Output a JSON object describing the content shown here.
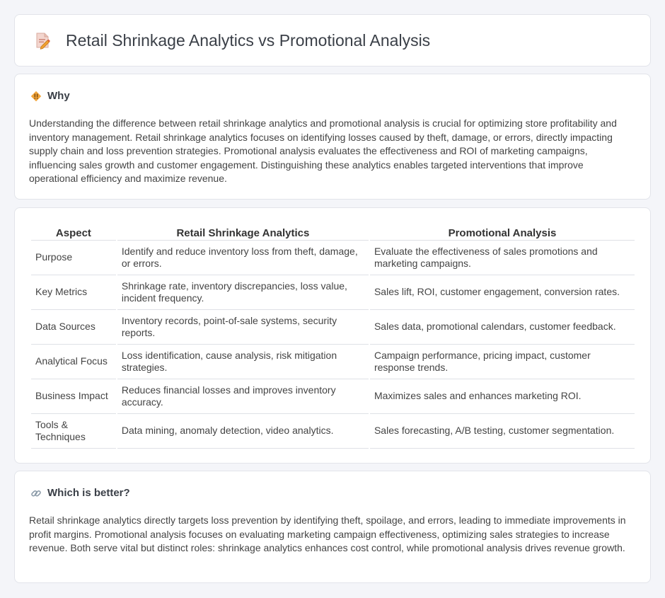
{
  "header": {
    "title": "Retail Shrinkage Analytics vs Promotional Analysis",
    "icon": "document-pencil-icon"
  },
  "why": {
    "title": "Why",
    "icon": "diamond-alert-icon",
    "text": "Understanding the difference between retail shrinkage analytics and promotional analysis is crucial for optimizing store profitability and inventory management. Retail shrinkage analytics focuses on identifying losses caused by theft, damage, or errors, directly impacting supply chain and loss prevention strategies. Promotional analysis evaluates the effectiveness and ROI of marketing campaigns, influencing sales growth and customer engagement. Distinguishing these analytics enables targeted interventions that improve operational efficiency and maximize revenue."
  },
  "table": {
    "headers": [
      "Aspect",
      "Retail Shrinkage Analytics",
      "Promotional Analysis"
    ],
    "rows": [
      [
        "Purpose",
        "Identify and reduce inventory loss from theft, damage, or errors.",
        "Evaluate the effectiveness of sales promotions and marketing campaigns."
      ],
      [
        "Key Metrics",
        "Shrinkage rate, inventory discrepancies, loss value, incident frequency.",
        "Sales lift, ROI, customer engagement, conversion rates."
      ],
      [
        "Data Sources",
        "Inventory records, point-of-sale systems, security reports.",
        "Sales data, promotional calendars, customer feedback."
      ],
      [
        "Analytical Focus",
        "Loss identification, cause analysis, risk mitigation strategies.",
        "Campaign performance, pricing impact, customer response trends."
      ],
      [
        "Business Impact",
        "Reduces financial losses and improves inventory accuracy.",
        "Maximizes sales and enhances marketing ROI."
      ],
      [
        "Tools & Techniques",
        "Data mining, anomaly detection, video analytics.",
        "Sales forecasting, A/B testing, customer segmentation."
      ]
    ]
  },
  "better": {
    "title": "Which is better?",
    "icon": "link-icon",
    "text": "Retail shrinkage analytics directly targets loss prevention by identifying theft, spoilage, and errors, leading to immediate improvements in profit margins. Promotional analysis focuses on evaluating marketing campaign effectiveness, optimizing sales strategies to increase revenue. Both serve vital but distinct roles: shrinkage analytics enhances cost control, while promotional analysis drives revenue growth."
  },
  "colors": {
    "background": "#f4f5f9",
    "card": "#ffffff",
    "border": "#e2e4ea",
    "accent": "#f0a030"
  }
}
